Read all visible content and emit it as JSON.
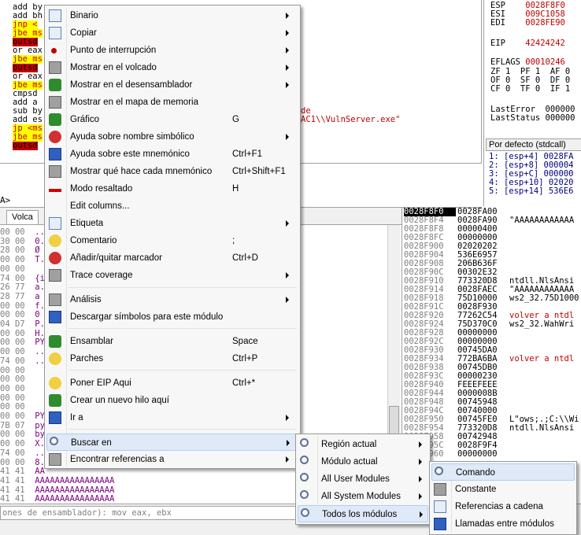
{
  "disasm_lines": [
    {
      "text": "add by",
      "cls": "hl-blk"
    },
    {
      "text": "add bh",
      "cls": "hl-blk"
    },
    {
      "text": "jnp <",
      "cls": "hl-jnp"
    },
    {
      "text": "jbe ms",
      "cls": "hl-jbe"
    },
    {
      "text": "outsd",
      "cls": "hl-red"
    },
    {
      "text": "or eax",
      "cls": "hl-blk"
    },
    {
      "text": "jbe ms",
      "cls": "hl-jbe"
    },
    {
      "text": "outsd",
      "cls": "hl-red"
    },
    {
      "text": "or eax",
      "cls": "hl-blk"
    },
    {
      "text": "jbe ms",
      "cls": "hl-jbe"
    },
    {
      "text": "cmpsd",
      "cls": "hl-blk"
    },
    {
      "text": "add a",
      "cls": "hl-blk"
    },
    {
      "text": "sub by",
      "cls": "hl-blk"
    },
    {
      "text": "add es",
      "cls": "hl-blk"
    },
    {
      "text": "jp <ms",
      "cls": "hl-jnp"
    },
    {
      "text": "jbe ms",
      "cls": "hl-jbe"
    },
    {
      "text": "outsd",
      "cls": "hl-red"
    }
  ],
  "disasm_comment_1": "de",
  "disasm_comment_2": "AC1\\\\VulnServer.exe\"",
  "registers": [
    {
      "name": "ESP",
      "value": "0028F8F0"
    },
    {
      "name": "ESI",
      "value": "009C1058"
    },
    {
      "name": "EDI",
      "value": "0028FE90"
    },
    {
      "name": "EIP",
      "value": "42424242"
    },
    {
      "name": "EFLAGS",
      "value": "00010246"
    }
  ],
  "flags": [
    "ZF 1  PF 1  AF 0",
    "OF 0  SF 0  DF 0",
    "CF 0  TF 0  IF 1"
  ],
  "last_error": "LastError  000000",
  "last_status": "LastStatus 000000",
  "call_convention": "Por defecto (stdcall)",
  "call_rows": [
    "1: [esp+4] 0028FA",
    "2: [esp+8] 000004",
    "3: [esp+C] 000000",
    "4: [esp+10] 02020",
    "5: [esp+14] 536E6"
  ],
  "info_marker": "A>",
  "dump_tab": "Volca",
  "dump_rows": [
    {
      "hex": "00 00",
      "asc": ".."
    },
    {
      "hex": "30 00",
      "asc": "0."
    },
    {
      "hex": "28 00",
      "asc": "Ø"
    },
    {
      "hex": "00 00",
      "asc": "T."
    },
    {
      "hex": "00 00",
      "asc": ""
    },
    {
      "hex": "74 00",
      "asc": "{i"
    },
    {
      "hex": "26 77",
      "asc": "a."
    },
    {
      "hex": "28 77",
      "asc": "a"
    },
    {
      "hex": "00 00",
      "asc": "f."
    },
    {
      "hex": "00 00",
      "asc": "0"
    },
    {
      "hex": "04 D7",
      "asc": "P."
    },
    {
      "hex": "00 00",
      "asc": "H."
    },
    {
      "hex": "00 00",
      "asc": "PY"
    },
    {
      "hex": "00 00",
      "asc": ".."
    },
    {
      "hex": "74 00",
      "asc": ".."
    },
    {
      "hex": "00 00",
      "asc": ""
    },
    {
      "hex": "00 00",
      "asc": ""
    },
    {
      "hex": "00 00",
      "asc": ""
    },
    {
      "hex": "00 00",
      "asc": ""
    },
    {
      "hex": "00 00",
      "asc": ""
    },
    {
      "hex": "00 00",
      "asc": "PY"
    },
    {
      "hex": "7B 07",
      "asc": "py"
    },
    {
      "hex": "00 00",
      "asc": "by"
    },
    {
      "hex": "00 00",
      "asc": "X."
    },
    {
      "hex": "74 00",
      "asc": "..."
    },
    {
      "hex": "00 00",
      "asc": "8."
    },
    {
      "hex": "41 41",
      "asc": "AA"
    },
    {
      "hex": "41 41",
      "asc": "AAAAAAAAAAAAAAAA"
    },
    {
      "hex": "41 41",
      "asc": "AAAAAAAAAAAAAAAA"
    },
    {
      "hex": "41 41",
      "asc": "AAAAAAAAAAAAAAAA"
    }
  ],
  "stack_rows": [
    {
      "addr": "0028F8F0",
      "val": "0028FA00",
      "com": "",
      "red": false,
      "cur": true
    },
    {
      "addr": "0028F8F4",
      "val": "0028FA90",
      "com": "\"AAAAAAAAAAAA",
      "red": false,
      "cur": false
    },
    {
      "addr": "0028F8F8",
      "val": "00000400",
      "com": "",
      "red": false,
      "cur": false
    },
    {
      "addr": "0028F8FC",
      "val": "00000000",
      "com": "",
      "red": false,
      "cur": false
    },
    {
      "addr": "0028F900",
      "val": "02020202",
      "com": "",
      "red": false,
      "cur": false
    },
    {
      "addr": "0028F904",
      "val": "536E6957",
      "com": "",
      "red": false,
      "cur": false
    },
    {
      "addr": "0028F908",
      "val": "206B636F",
      "com": "",
      "red": false,
      "cur": false
    },
    {
      "addr": "0028F90C",
      "val": "00302E32",
      "com": "",
      "red": false,
      "cur": false
    },
    {
      "addr": "0028F910",
      "val": "773320D8",
      "com": "ntdll.NlsAnsi",
      "red": false,
      "cur": false
    },
    {
      "addr": "0028F914",
      "val": "0028FAEC",
      "com": "\"AAAAAAAAAAAA",
      "red": false,
      "cur": false
    },
    {
      "addr": "0028F918",
      "val": "75D10000",
      "com": "ws2_32.75D1000",
      "red": false,
      "cur": false
    },
    {
      "addr": "0028F91C",
      "val": "0028F930",
      "com": "",
      "red": false,
      "cur": false
    },
    {
      "addr": "0028F920",
      "val": "77262C54",
      "com": "volver a ntdl",
      "red": true,
      "cur": false
    },
    {
      "addr": "0028F924",
      "val": "75D370C0",
      "com": "ws2_32.WahWri",
      "red": false,
      "cur": false
    },
    {
      "addr": "0028F928",
      "val": "00000000",
      "com": "",
      "red": false,
      "cur": false
    },
    {
      "addr": "0028F92C",
      "val": "00000000",
      "com": "",
      "red": false,
      "cur": false
    },
    {
      "addr": "0028F930",
      "val": "00745DA0",
      "com": "",
      "red": false,
      "cur": false
    },
    {
      "addr": "0028F934",
      "val": "772BA6BA",
      "com": "volver a ntdl",
      "red": true,
      "cur": false
    },
    {
      "addr": "0028F938",
      "val": "00745DB0",
      "com": "",
      "red": false,
      "cur": false
    },
    {
      "addr": "0028F93C",
      "val": "00000230",
      "com": "",
      "red": false,
      "cur": false
    },
    {
      "addr": "0028F940",
      "val": "FEEEFEEE",
      "com": "",
      "red": false,
      "cur": false
    },
    {
      "addr": "0028F944",
      "val": "0000008B",
      "com": "",
      "red": false,
      "cur": false
    },
    {
      "addr": "0028F948",
      "val": "00745948",
      "com": "",
      "red": false,
      "cur": false
    },
    {
      "addr": "0028F94C",
      "val": "00740000",
      "com": "",
      "red": false,
      "cur": false
    },
    {
      "addr": "0028F950",
      "val": "00745FE0",
      "com": "L\"ows;.;C:\\\\Wi",
      "red": false,
      "cur": false
    },
    {
      "addr": "0028F954",
      "val": "773320D8",
      "com": "ntdll.NlsAnsi",
      "red": false,
      "cur": false
    },
    {
      "addr": "0028F958",
      "val": "00742948",
      "com": "",
      "red": false,
      "cur": false
    },
    {
      "addr": "0028F95C",
      "val": "0028F9F4",
      "com": "",
      "red": false,
      "cur": false
    },
    {
      "addr": "0028F960",
      "val": "00000000",
      "com": "",
      "red": false,
      "cur": false
    }
  ],
  "cmd_placeholder": "ones de ensamblador): mov eax, ebx",
  "menu_main": [
    {
      "label": "Binario",
      "shortcut": "",
      "arrow": true,
      "icon": "binary-icon",
      "iconcls": "ic-box"
    },
    {
      "label": "Copiar",
      "shortcut": "",
      "arrow": true,
      "icon": "copy-icon",
      "iconcls": "ic-box"
    },
    {
      "label": "Punto de interrupción",
      "shortcut": "",
      "arrow": true,
      "icon": "breakpoint-icon",
      "iconcls": "ic-dot"
    },
    {
      "label": "Mostrar en el volcado",
      "shortcut": "",
      "arrow": true,
      "icon": "dump-icon",
      "iconcls": "ic-gray"
    },
    {
      "label": "Mostrar en el desensamblador",
      "shortcut": "",
      "arrow": true,
      "icon": "cpu-icon",
      "iconcls": "ic-green"
    },
    {
      "label": "Mostrar en el mapa de memoria",
      "shortcut": "",
      "arrow": false,
      "icon": "memory-map-icon",
      "iconcls": "ic-gray"
    },
    {
      "label": "Gráfico",
      "shortcut": "G",
      "arrow": false,
      "icon": "graph-icon",
      "iconcls": "ic-green"
    },
    {
      "label": "Ayuda sobre nombre simbólico",
      "shortcut": "",
      "arrow": true,
      "icon": "help-lifebuoy-icon",
      "iconcls": "ic-red"
    },
    {
      "label": "Ayuda sobre este mnemónico",
      "shortcut": "Ctrl+F1",
      "arrow": false,
      "icon": "help-book-icon",
      "iconcls": "ic-blue"
    },
    {
      "label": "Mostrar qué hace cada mnemónico",
      "shortcut": "Ctrl+Shift+F1",
      "arrow": false,
      "icon": "penguin-icon",
      "iconcls": "ic-gray"
    },
    {
      "label": "Modo resaltado",
      "shortcut": "H",
      "arrow": false,
      "icon": "highlight-icon",
      "iconcls": "ic-redbar"
    },
    {
      "label": "Edit columns...",
      "shortcut": "",
      "arrow": false,
      "icon": "",
      "iconcls": ""
    },
    {
      "label": "Etiqueta",
      "shortcut": "",
      "arrow": true,
      "icon": "label-icon",
      "iconcls": "ic-box"
    },
    {
      "label": "Comentario",
      "shortcut": ";",
      "arrow": false,
      "icon": "comment-icon",
      "iconcls": "ic-yellow"
    },
    {
      "label": "Añadir/quitar marcador",
      "shortcut": "Ctrl+D",
      "arrow": false,
      "icon": "bookmark-icon",
      "iconcls": "ic-red"
    },
    {
      "label": "Trace coverage",
      "shortcut": "",
      "arrow": true,
      "icon": "trace-icon",
      "iconcls": "ic-gray"
    },
    {
      "label": "Análisis",
      "shortcut": "",
      "arrow": true,
      "icon": "analysis-wand-icon",
      "iconcls": "ic-gray"
    },
    {
      "label": "Descargar símbolos para este módulo",
      "shortcut": "",
      "arrow": false,
      "icon": "download-symbols-icon",
      "iconcls": "ic-blue"
    },
    {
      "label": "Ensamblar",
      "shortcut": "Space",
      "arrow": false,
      "icon": "assemble-icon",
      "iconcls": "ic-green"
    },
    {
      "label": "Parches",
      "shortcut": "Ctrl+P",
      "arrow": false,
      "icon": "patch-bandage-icon",
      "iconcls": "ic-yellow"
    },
    {
      "label": "Poner EIP Aqui",
      "shortcut": "Ctrl+*",
      "arrow": false,
      "icon": "set-eip-icon",
      "iconcls": "ic-yellow"
    },
    {
      "label": "Crear un nuevo hilo aquí",
      "shortcut": "",
      "arrow": false,
      "icon": "new-thread-icon",
      "iconcls": "ic-green"
    },
    {
      "label": "Ir a",
      "shortcut": "",
      "arrow": true,
      "icon": "goto-icon",
      "iconcls": "ic-blue"
    },
    {
      "label": "Buscar en",
      "shortcut": "",
      "arrow": true,
      "icon": "search-in-icon",
      "iconcls": "ic-mag"
    },
    {
      "label": "Encontrar referencias a",
      "shortcut": "",
      "arrow": true,
      "icon": "binoculars-icon",
      "iconcls": "ic-gray"
    }
  ],
  "menu_search": [
    {
      "label": "Región actual",
      "arrow": true,
      "icon": "search-region-icon"
    },
    {
      "label": "Módulo actual",
      "arrow": true,
      "icon": "search-module-icon"
    },
    {
      "label": "All User Modules",
      "arrow": true,
      "icon": "search-user-modules-icon"
    },
    {
      "label": "All System Modules",
      "arrow": true,
      "icon": "search-system-modules-icon"
    },
    {
      "label": "Todos los módulos",
      "arrow": true,
      "icon": "search-all-modules-icon"
    }
  ],
  "menu_all_modules": [
    {
      "label": "Comando",
      "icon": "command-search-icon"
    },
    {
      "label": "Constante",
      "icon": "constant-search-icon"
    },
    {
      "label": "Referencias a cadena",
      "icon": "string-refs-icon"
    },
    {
      "label": "Llamadas entre módulos",
      "icon": "intermodular-calls-icon"
    }
  ]
}
